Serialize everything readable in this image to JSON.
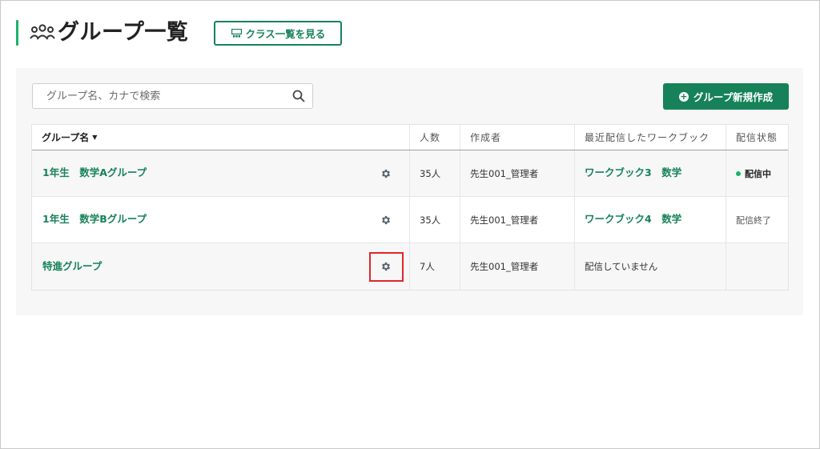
{
  "header": {
    "title": "グループ一覧",
    "class_button_label": "クラス一覧を見る"
  },
  "search": {
    "placeholder": "グループ名、カナで検索",
    "value": ""
  },
  "new_group_button_label": "グループ新規作成",
  "table": {
    "columns": [
      "グループ名",
      "人数",
      "作成者",
      "最近配信したワークブック",
      "配信状態"
    ],
    "rows": [
      {
        "group": "1年生　数学Aグループ",
        "members": "35人",
        "creator": "先生001_管理者",
        "workbook": "ワークブック3　数学",
        "status": "配信中"
      },
      {
        "group": "1年生　数学Bグループ",
        "members": "35人",
        "creator": "先生001_管理者",
        "workbook": "ワークブック4　数学",
        "status": "配信終了"
      },
      {
        "group": "特進グループ",
        "members": "7人",
        "creator": "先生001_管理者",
        "workbook": "配信していません",
        "status": ""
      }
    ]
  },
  "colors": {
    "brand": "#17825a",
    "accent": "#19b36b",
    "highlight": "#e0262d"
  },
  "icons": {
    "title_icon": "people-group-icon",
    "class_icon": "classroom-icon",
    "search_icon": "search-icon",
    "new_icon": "plus-circle-icon",
    "settings_icon": "gear-icon",
    "sort_icon": "caret-down-icon"
  }
}
